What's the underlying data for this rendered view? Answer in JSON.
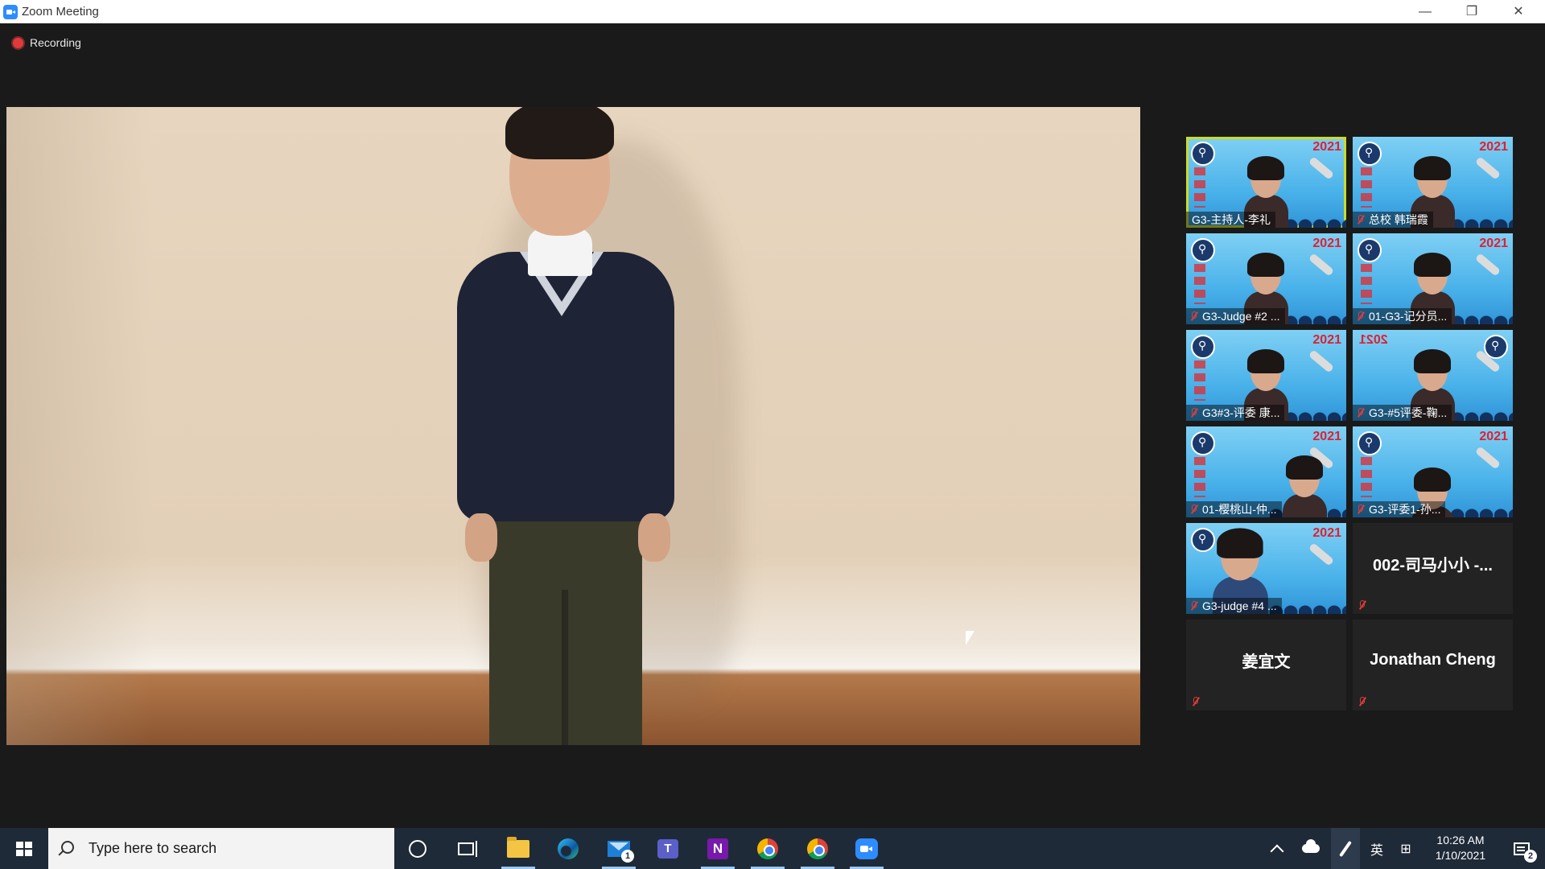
{
  "window": {
    "title": "Zoom Meeting",
    "icon": "zoom-app-icon",
    "controls": [
      "minimize-icon",
      "restore-icon",
      "close-icon"
    ]
  },
  "meeting": {
    "recording_label": "Recording",
    "active_speaker_video": "child-speaker"
  },
  "gallery": {
    "tiles": [
      {
        "name": "G3-主持人-李礼",
        "video": true,
        "muted": false,
        "active": true
      },
      {
        "name": "总校 韩瑞霞",
        "video": true,
        "muted": true
      },
      {
        "name": "G3-Judge #2 ...",
        "video": true,
        "muted": true
      },
      {
        "name": "01-G3-记分员...",
        "video": true,
        "muted": true
      },
      {
        "name": "G3#3-评委 康...",
        "video": true,
        "muted": true
      },
      {
        "name": "G3-#5评委-鞠...",
        "video": true,
        "muted": true
      },
      {
        "name": "01-樱桃山-仲...",
        "video": true,
        "muted": true
      },
      {
        "name": "G3-评委1-孙...",
        "video": true,
        "muted": true
      },
      {
        "name": "G3-judge #4 ...",
        "video": true,
        "muted": true
      },
      {
        "name": "002-司马小小 -...",
        "video": false,
        "muted": true
      },
      {
        "name": "姜宜文",
        "video": false,
        "muted": true
      },
      {
        "name": "Jonathan Cheng",
        "video": false,
        "muted": true
      }
    ],
    "virtual_background_year": "2021"
  },
  "taskbar": {
    "search_placeholder": "Type here to search",
    "mail_badge": "1",
    "input_method": "英",
    "time": "10:26 AM",
    "date": "1/10/2021",
    "notification_count": "2"
  },
  "colors": {
    "active_speaker_border": "#c9dc2a",
    "taskbar": "#1f2a38",
    "zoom_blue": "#2d8cff"
  }
}
